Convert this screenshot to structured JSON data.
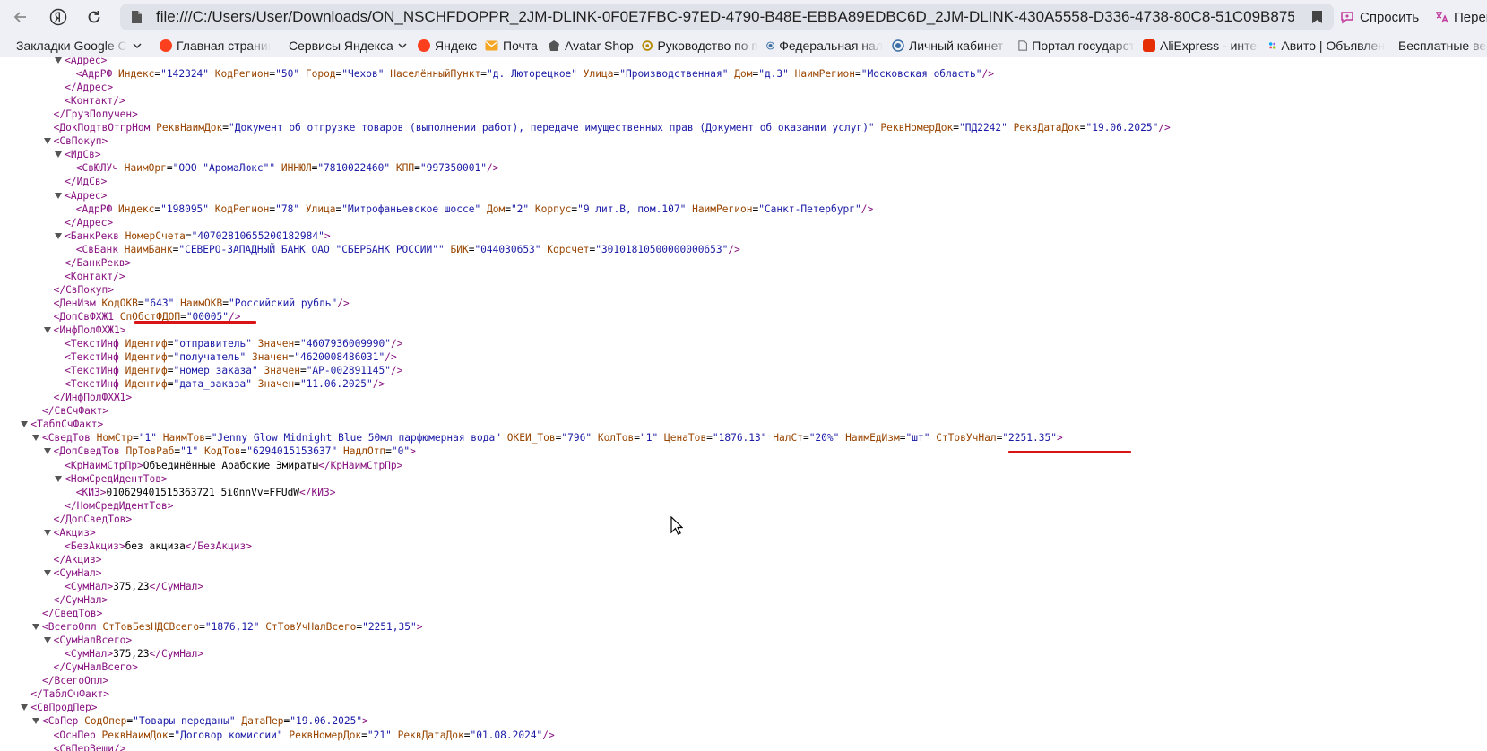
{
  "browser": {
    "url": "file:///C:/Users/User/Downloads/ON_NSCHFDOPPR_2JM-DLINK-0F0E7FBC-97ED-4790-B48E-EBBA89EDBC6D_2JM-DLINK-430A5558-D336-4738-80C8-51C09B875ECD_...",
    "ask_label": "Спросить",
    "translate_label": "Перев"
  },
  "bookmarks": [
    {
      "label": "Закладки Google Ch",
      "icon": "folder-icon"
    },
    {
      "label": "Главная страница",
      "icon": "yandex-icon",
      "color": "#fc3f1d"
    },
    {
      "label": "Сервисы Яндекса",
      "icon": "chevron-down-icon"
    },
    {
      "label": "Яндекс",
      "icon": "yandex-icon",
      "color": "#fc3f1d"
    },
    {
      "label": "Почта",
      "icon": "mail-icon",
      "color": "#f5a623"
    },
    {
      "label": "Avatar Shop",
      "icon": "avatar-icon",
      "color": "#555555"
    },
    {
      "label": "Руководство по п",
      "icon": "gear-icon",
      "color": "#b58900"
    },
    {
      "label": "Федеральная нал",
      "icon": "emblem-icon",
      "color": "#3a6ea5"
    },
    {
      "label": "Личный кабинет",
      "icon": "emblem-icon",
      "color": "#3a6ea5"
    },
    {
      "label": "Портал государст",
      "icon": "document-icon",
      "color": "#777777"
    },
    {
      "label": "AliExpress - интер",
      "icon": "aliexpress-icon",
      "color": "#e62e04"
    },
    {
      "label": "Авито | Объявлен",
      "icon": "avito-icon",
      "color": "#965eeb"
    },
    {
      "label": "Бесплатные веб",
      "icon": "star-icon",
      "color": "#2a7de1"
    }
  ],
  "xml_lines": [
    {
      "t": "<Адрес>",
      "tri": true,
      "ind": 2
    },
    {
      "tag": "АдрРФ",
      "ind": 3,
      "attrs": [
        [
          "Индекс",
          "142324"
        ],
        [
          "КодРегион",
          "50"
        ],
        [
          "Город",
          "Чехов"
        ],
        [
          "НаселённыйПункт",
          "д. Люторецкое"
        ],
        [
          "Улица",
          "Производственная"
        ],
        [
          "Дом",
          "д.3"
        ],
        [
          "НаимРегион",
          "Московская область"
        ]
      ],
      "self": true
    },
    {
      "close": "Адрес",
      "ind": 2
    },
    {
      "tag": "Контакт",
      "ind": 2,
      "self": true
    },
    {
      "close": "ГрузПолучен",
      "ind": 1
    },
    {
      "tag": "ДокПодтвОтгрНом",
      "ind": 1,
      "attrs": [
        [
          "РеквНаимДок",
          "Документ об отгрузке товаров (выполнении работ), передаче имущественных прав (Документ об оказании услуг)"
        ],
        [
          "РеквНомерДок",
          "ПД2242"
        ],
        [
          "РеквДатаДок",
          "19.06.2025"
        ]
      ],
      "self": true
    },
    {
      "tag": "СвПокуп",
      "ind": 1,
      "tri": true
    },
    {
      "tag": "ИдСв",
      "ind": 2,
      "tri": true
    },
    {
      "tag": "СвЮЛУч",
      "ind": 3,
      "attrs": [
        [
          "НаимОрг",
          "ООО \"АромаЛюкс\""
        ],
        [
          "ИННЮЛ",
          "7810022460"
        ],
        [
          "КПП",
          "997350001"
        ]
      ],
      "self": true
    },
    {
      "close": "ИдСв",
      "ind": 2
    },
    {
      "tag": "Адрес",
      "ind": 2,
      "tri": true
    },
    {
      "tag": "АдрРФ",
      "ind": 3,
      "attrs": [
        [
          "Индекс",
          "198095"
        ],
        [
          "КодРегион",
          "78"
        ],
        [
          "Улица",
          "Митрофаньевское шоссе"
        ],
        [
          "Дом",
          "2"
        ],
        [
          "Корпус",
          "9 лит.В, пом.107"
        ],
        [
          "НаимРегион",
          "Санкт-Петербург"
        ]
      ],
      "self": true
    },
    {
      "close": "Адрес",
      "ind": 2
    },
    {
      "tag": "БанкРекв",
      "ind": 2,
      "tri": true,
      "attrs": [
        [
          "НомерСчета",
          "40702810655200182984"
        ]
      ]
    },
    {
      "tag": "СвБанк",
      "ind": 3,
      "attrs": [
        [
          "НаимБанк",
          "СЕВЕРО-ЗАПАДНЫЙ БАНК ОАО \"СБЕРБАНК РОССИИ\""
        ],
        [
          "БИК",
          "044030653"
        ],
        [
          "Корсчет",
          "30101810500000000653"
        ]
      ],
      "self": true
    },
    {
      "close": "БанкРекв",
      "ind": 2
    },
    {
      "tag": "Контакт",
      "ind": 2,
      "self": true
    },
    {
      "close": "СвПокуп",
      "ind": 1
    },
    {
      "tag": "ДенИзм",
      "ind": 1,
      "attrs": [
        [
          "КодОКВ",
          "643"
        ],
        [
          "НаимОКВ",
          "Российский рубль"
        ]
      ],
      "self": true
    },
    {
      "tag": "ДопСвФХЖ1",
      "ind": 1,
      "attrs": [
        [
          "СпОбстФДОП",
          "00005"
        ]
      ],
      "self": true
    },
    {
      "tag": "ИнфПолФХЖ1",
      "ind": 1,
      "tri": true
    },
    {
      "tag": "ТекстИнф",
      "ind": 2,
      "attrs": [
        [
          "Идентиф",
          "отправитель"
        ],
        [
          "Значен",
          "4607936009990"
        ]
      ],
      "self": true
    },
    {
      "tag": "ТекстИнф",
      "ind": 2,
      "attrs": [
        [
          "Идентиф",
          "получатель"
        ],
        [
          "Значен",
          "4620008486031"
        ]
      ],
      "self": true
    },
    {
      "tag": "ТекстИнф",
      "ind": 2,
      "attrs": [
        [
          "Идентиф",
          "номер_заказа"
        ],
        [
          "Значен",
          "AP-002891145"
        ]
      ],
      "self": true
    },
    {
      "tag": "ТекстИнф",
      "ind": 2,
      "attrs": [
        [
          "Идентиф",
          "дата_заказа"
        ],
        [
          "Значен",
          "11.06.2025"
        ]
      ],
      "self": true
    },
    {
      "close": "ИнфПолФХЖ1",
      "ind": 1
    },
    {
      "close": "СвСчФакт",
      "ind": 0
    },
    {
      "tag": "ТаблСчФакт",
      "ind": -1,
      "tri": true
    },
    {
      "tag": "СведТов",
      "ind": 0,
      "tri": true,
      "attrs": [
        [
          "НомСтр",
          "1"
        ],
        [
          "НаимТов",
          "Jenny Glow Midnight Blue 50мл парфюмерная вода"
        ],
        [
          "ОКЕИ_Тов",
          "796"
        ],
        [
          "КолТов",
          "1"
        ],
        [
          "ЦенаТов",
          "1876.13"
        ],
        [
          "НалСт",
          "20%"
        ],
        [
          "НаимЕдИзм",
          "шт"
        ],
        [
          "СтТовУчНал",
          "2251.35"
        ]
      ]
    },
    {
      "tag": "ДопСведТов",
      "ind": 1,
      "tri": true,
      "attrs": [
        [
          "ПрТовРаб",
          "1"
        ],
        [
          "КодТов",
          "6294015153637"
        ],
        [
          "НадлОтп",
          "0"
        ]
      ]
    },
    {
      "tag": "КрНаимСтрПр",
      "ind": 2,
      "text": "Объединённые Арабские Эмираты"
    },
    {
      "tag": "НомСредИдентТов",
      "ind": 2,
      "tri": true
    },
    {
      "tag": "КИЗ",
      "ind": 3,
      "text": "010629401515363721 5i0nnVv=FFUdW"
    },
    {
      "close": "НомСредИдентТов",
      "ind": 2
    },
    {
      "close": "ДопСведТов",
      "ind": 1
    },
    {
      "tag": "Акциз",
      "ind": 1,
      "tri": true
    },
    {
      "tag": "БезАкциз",
      "ind": 2,
      "text": "без акциза"
    },
    {
      "close": "Акциз",
      "ind": 1
    },
    {
      "tag": "СумНал",
      "ind": 1,
      "tri": true
    },
    {
      "tag": "СумНал",
      "ind": 2,
      "text": "375,23"
    },
    {
      "close": "СумНал",
      "ind": 1
    },
    {
      "close": "СведТов",
      "ind": 0
    },
    {
      "tag": "ВсегоОпл",
      "ind": 0,
      "tri": true,
      "attrs": [
        [
          "СтТовБезНДСВсего",
          "1876,12"
        ],
        [
          "СтТовУчНалВсего",
          "2251,35"
        ]
      ]
    },
    {
      "tag": "СумНалВсего",
      "ind": 1,
      "tri": true
    },
    {
      "tag": "СумНал",
      "ind": 2,
      "text": "375,23"
    },
    {
      "close": "СумНалВсего",
      "ind": 1
    },
    {
      "close": "ВсегоОпл",
      "ind": 0
    },
    {
      "close": "ТаблСчФакт",
      "ind": -1
    },
    {
      "tag": "СвПродПер",
      "ind": -1,
      "tri": true
    },
    {
      "tag": "СвПер",
      "ind": 0,
      "tri": true,
      "attrs": [
        [
          "СодОпер",
          "Товары переданы"
        ],
        [
          "ДатаПер",
          "19.06.2025"
        ]
      ]
    },
    {
      "tag": "ОснПер",
      "ind": 1,
      "attrs": [
        [
          "РеквНаимДок",
          "Договор комиссии"
        ],
        [
          "РеквНомерДок",
          "21"
        ],
        [
          "РеквДатаДок",
          "01.08.2024"
        ]
      ],
      "self": true
    },
    {
      "tag": "СвПерВещи",
      "ind": 1,
      "self": true
    }
  ]
}
